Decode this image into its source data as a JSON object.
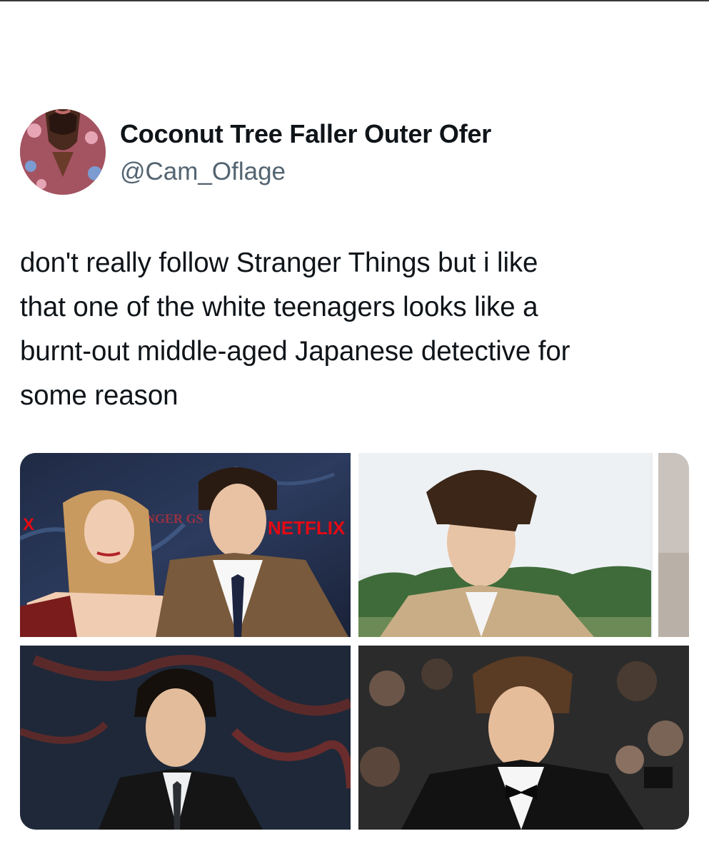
{
  "tweet": {
    "author": {
      "display_name": "Coconut Tree Faller Outer Ofer",
      "handle": "@Cam_Oflage",
      "avatar_icon": "user-avatar"
    },
    "text_lines": [
      "don't really follow Stranger Things but i like",
      "that one of the white teenagers looks like a",
      "burnt-out middle-aged Japanese detective for",
      "some reason"
    ],
    "media": [
      {
        "sign_text": "NETFLIX",
        "logo_fragment_left": "X",
        "backdrop_text": "NGER GS"
      },
      {
        "description_icon": "portrait-photo"
      },
      {
        "description_icon": "portrait-photo"
      },
      {
        "description_icon": "portrait-photo"
      }
    ]
  },
  "colors": {
    "text_primary": "#0f1419",
    "text_secondary": "#536471",
    "netflix_red": "#e50914"
  }
}
